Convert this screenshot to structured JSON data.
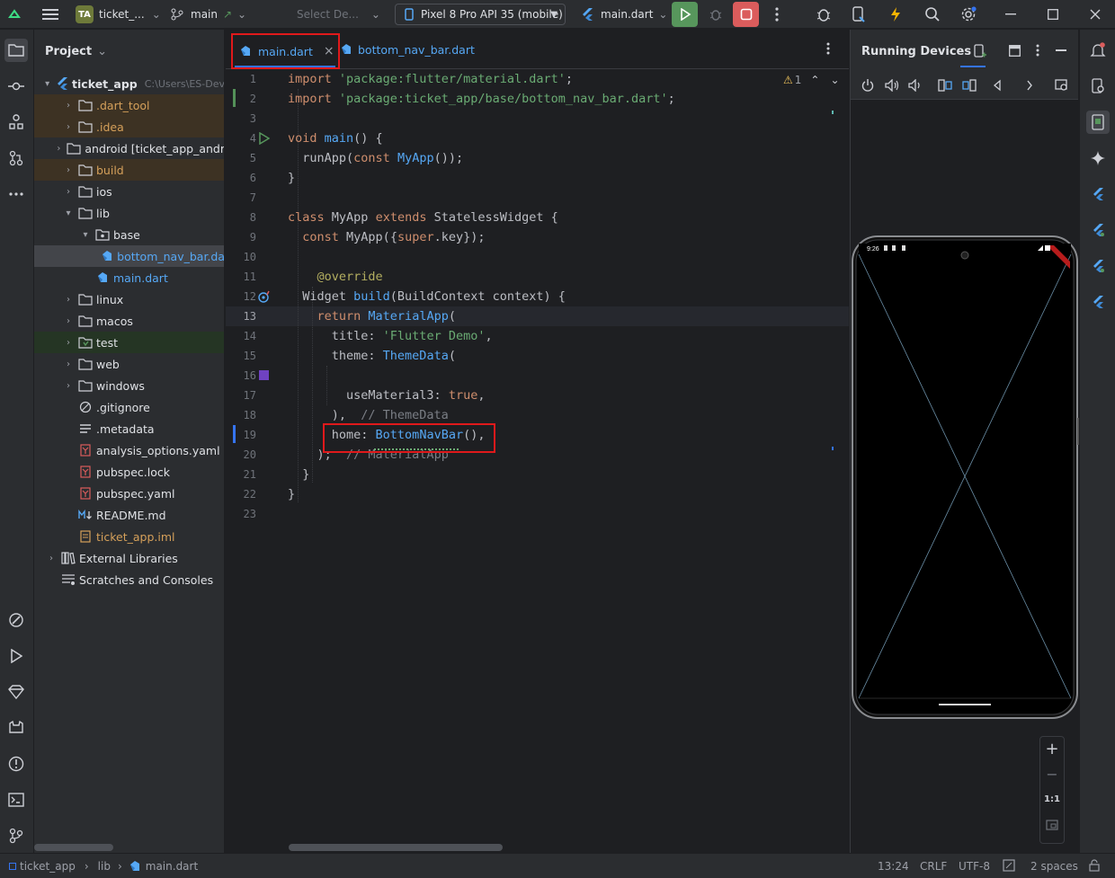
{
  "toolbar": {
    "project_badge": "TA",
    "project_name": "ticket_...",
    "branch": "main",
    "config_placeholder": "Select De...",
    "device": "Pixel 8 Pro API 35 (mobile)",
    "run_config": "main.dart"
  },
  "project_panel": {
    "title": "Project",
    "tree": [
      {
        "label": "ticket_app",
        "suffix": "C:\\Users\\ES-Dev",
        "depth": 0,
        "chev": "▾",
        "icon": "flutter-project-icon",
        "style": "root"
      },
      {
        "label": ".dart_tool",
        "depth": 1,
        "chev": "›",
        "icon": "folder-icon",
        "style": "excluded"
      },
      {
        "label": ".idea",
        "depth": 1,
        "chev": "›",
        "icon": "folder-icon",
        "style": "excluded"
      },
      {
        "label": "android [ticket_app_andr",
        "depth": 1,
        "chev": "›",
        "icon": "folder-icon",
        "style": "normal"
      },
      {
        "label": "build",
        "depth": 1,
        "chev": "›",
        "icon": "folder-icon",
        "style": "excluded"
      },
      {
        "label": "ios",
        "depth": 1,
        "chev": "›",
        "icon": "folder-icon",
        "style": "normal"
      },
      {
        "label": "lib",
        "depth": 1,
        "chev": "▾",
        "icon": "folder-icon",
        "style": "normal"
      },
      {
        "label": "base",
        "depth": 2,
        "chev": "▾",
        "icon": "package-icon",
        "style": "normal"
      },
      {
        "label": "bottom_nav_bar.da",
        "depth": 3,
        "chev": "",
        "icon": "dart-file-icon",
        "style": "selected"
      },
      {
        "label": "main.dart",
        "depth": 2,
        "chev": "",
        "icon": "dart-file-icon",
        "style": "dart"
      },
      {
        "label": "linux",
        "depth": 1,
        "chev": "›",
        "icon": "folder-icon",
        "style": "normal"
      },
      {
        "label": "macos",
        "depth": 1,
        "chev": "›",
        "icon": "folder-icon",
        "style": "normal"
      },
      {
        "label": "test",
        "depth": 1,
        "chev": "›",
        "icon": "test-folder-icon",
        "style": "test"
      },
      {
        "label": "web",
        "depth": 1,
        "chev": "›",
        "icon": "folder-icon",
        "style": "normal"
      },
      {
        "label": "windows",
        "depth": 1,
        "chev": "›",
        "icon": "folder-icon",
        "style": "normal"
      },
      {
        "label": ".gitignore",
        "depth": 1,
        "chev": "",
        "icon": "ignore-file-icon",
        "style": "normal"
      },
      {
        "label": ".metadata",
        "depth": 1,
        "chev": "",
        "icon": "text-file-icon",
        "style": "normal"
      },
      {
        "label": "analysis_options.yaml",
        "depth": 1,
        "chev": "",
        "icon": "yaml-file-icon",
        "style": "normal"
      },
      {
        "label": "pubspec.lock",
        "depth": 1,
        "chev": "",
        "icon": "yaml-file-icon",
        "style": "normal"
      },
      {
        "label": "pubspec.yaml",
        "depth": 1,
        "chev": "",
        "icon": "yaml-file-icon",
        "style": "normal"
      },
      {
        "label": "README.md",
        "depth": 1,
        "chev": "",
        "icon": "markdown-file-icon",
        "style": "normal"
      },
      {
        "label": "ticket_app.iml",
        "depth": 1,
        "chev": "",
        "icon": "module-file-icon",
        "style": "iml"
      },
      {
        "label": "External Libraries",
        "depth": 0,
        "chev": "›",
        "icon": "library-icon",
        "style": "normal"
      },
      {
        "label": "Scratches and Consoles",
        "depth": 0,
        "chev": "",
        "icon": "scratches-icon",
        "style": "normal"
      }
    ]
  },
  "editor": {
    "tabs": [
      {
        "label": "main.dart",
        "active": true,
        "close": "×"
      },
      {
        "label": "bottom_nav_bar.dart",
        "active": false,
        "close": ""
      }
    ],
    "inspection": {
      "warnings": "1"
    },
    "current_line": 13,
    "lines": [
      [
        {
          "t": "import ",
          "c": "kw"
        },
        {
          "t": "'package:flutter/material.dart'",
          "c": "str"
        },
        {
          "t": ";",
          "c": "plain"
        }
      ],
      [
        {
          "t": "import ",
          "c": "kw"
        },
        {
          "t": "'package:ticket_app/base/bottom_nav_bar.dart'",
          "c": "str"
        },
        {
          "t": ";",
          "c": "plain"
        }
      ],
      [],
      [
        {
          "t": "void ",
          "c": "kw"
        },
        {
          "t": "main",
          "c": "cls"
        },
        {
          "t": "() {",
          "c": "plain"
        }
      ],
      [
        {
          "t": "  runApp(",
          "c": "plain"
        },
        {
          "t": "const ",
          "c": "kw"
        },
        {
          "t": "MyApp",
          "c": "cls"
        },
        {
          "t": "());",
          "c": "plain"
        }
      ],
      [
        {
          "t": "}",
          "c": "plain"
        }
      ],
      [],
      [
        {
          "t": "class ",
          "c": "kw"
        },
        {
          "t": "MyApp ",
          "c": "plain"
        },
        {
          "t": "extends ",
          "c": "kw"
        },
        {
          "t": "StatelessWidget {",
          "c": "plain"
        }
      ],
      [
        {
          "t": "  ",
          "c": "plain"
        },
        {
          "t": "const ",
          "c": "kw"
        },
        {
          "t": "MyApp({",
          "c": "plain"
        },
        {
          "t": "super",
          "c": "kw"
        },
        {
          "t": ".key});",
          "c": "plain"
        }
      ],
      [],
      [
        {
          "t": "    ",
          "c": "plain"
        },
        {
          "t": "@override",
          "c": "anno"
        }
      ],
      [
        {
          "t": "  Widget ",
          "c": "plain"
        },
        {
          "t": "build",
          "c": "cls"
        },
        {
          "t": "(BuildContext context) {",
          "c": "plain"
        }
      ],
      [
        {
          "t": "    ",
          "c": "plain"
        },
        {
          "t": "return ",
          "c": "kw"
        },
        {
          "t": "MaterialApp",
          "c": "cls"
        },
        {
          "t": "(",
          "c": "plain"
        }
      ],
      [
        {
          "t": "      title: ",
          "c": "plain"
        },
        {
          "t": "'Flutter Demo'",
          "c": "str"
        },
        {
          "t": ",",
          "c": "plain"
        }
      ],
      [
        {
          "t": "      theme: ",
          "c": "plain"
        },
        {
          "t": "ThemeData",
          "c": "cls"
        },
        {
          "t": "(",
          "c": "plain"
        }
      ],
      [],
      [
        {
          "t": "        useMaterial3: ",
          "c": "plain"
        },
        {
          "t": "true",
          "c": "kw"
        },
        {
          "t": ",",
          "c": "plain"
        }
      ],
      [
        {
          "t": "      ),  ",
          "c": "plain"
        },
        {
          "t": "// ThemeData",
          "c": "cmt"
        }
      ],
      [
        {
          "t": "      home: ",
          "c": "plain"
        },
        {
          "t": "BottomNavBar",
          "c": "cls"
        },
        {
          "t": "(),",
          "c": "plain"
        }
      ],
      [
        {
          "t": "    );  ",
          "c": "plain"
        },
        {
          "t": "// MaterialApp",
          "c": "cmt"
        }
      ],
      [
        {
          "t": "  }",
          "c": "plain"
        }
      ],
      [
        {
          "t": "}",
          "c": "plain"
        }
      ],
      []
    ]
  },
  "devices_panel": {
    "title": "Running Devices",
    "phone_time": "9:26",
    "zoom_in": "+",
    "zoom_out": "−",
    "zoom_actual": "1:1"
  },
  "statusbar": {
    "path": [
      "ticket_app",
      "lib",
      "main.dart"
    ],
    "position": "13:24",
    "line_sep": "CRLF",
    "encoding": "UTF-8",
    "indent": "2 spaces"
  },
  "colors": {
    "accent": "#3574f0",
    "run": "#57965c",
    "stop": "#db5c5c",
    "highlight_box": "#e0191b"
  }
}
